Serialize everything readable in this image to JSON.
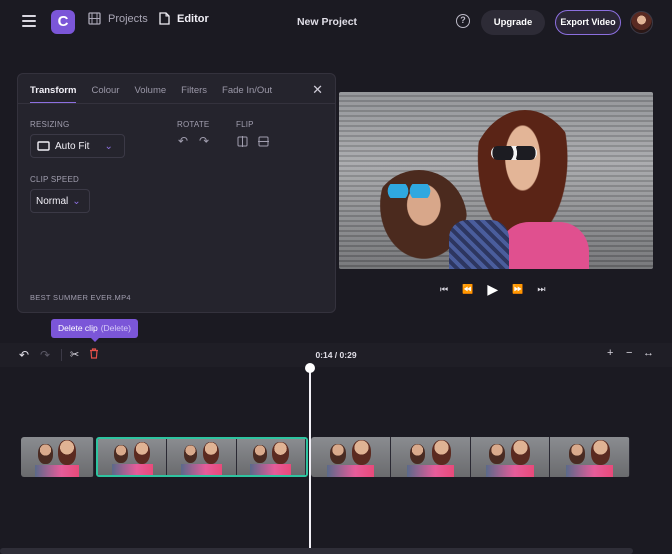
{
  "header": {
    "logo_letter": "C",
    "projects_label": "Projects",
    "editor_label": "Editor",
    "project_title": "New Project",
    "help_glyph": "?",
    "upgrade_label": "Upgrade",
    "export_label": "Export Video",
    "icons": [
      "menu-icon",
      "film-icon",
      "document-icon",
      "help-icon",
      "avatar"
    ]
  },
  "panel": {
    "tabs": [
      {
        "label": "Transform",
        "active": true
      },
      {
        "label": "Colour",
        "active": false
      },
      {
        "label": "Volume",
        "active": false
      },
      {
        "label": "Filters",
        "active": false
      },
      {
        "label": "Fade In/Out",
        "active": false
      }
    ],
    "close_glyph": "✕",
    "resizing_label": "RESIZING",
    "resizing_value": "Auto Fit",
    "rotate_label": "ROTATE",
    "flip_label": "FLIP",
    "clip_speed_label": "CLIP SPEED",
    "clip_speed_value": "Normal",
    "filename": "BEST SUMMER EVER.MP4"
  },
  "tooltip": {
    "label": "Delete clip",
    "shortcut": "(Delete)"
  },
  "timeline": {
    "time_display": "0:14 / 0:29",
    "zoom_in": "+",
    "zoom_out": "−",
    "fit": "↔",
    "clips": [
      {
        "frames": 1,
        "selected": false
      },
      {
        "frames": 3,
        "selected": true
      },
      {
        "frames": 4,
        "selected": false
      }
    ]
  },
  "colors": {
    "accent": "#7b56d8",
    "selection": "#2ec4a0",
    "delete": "#e8514a"
  }
}
